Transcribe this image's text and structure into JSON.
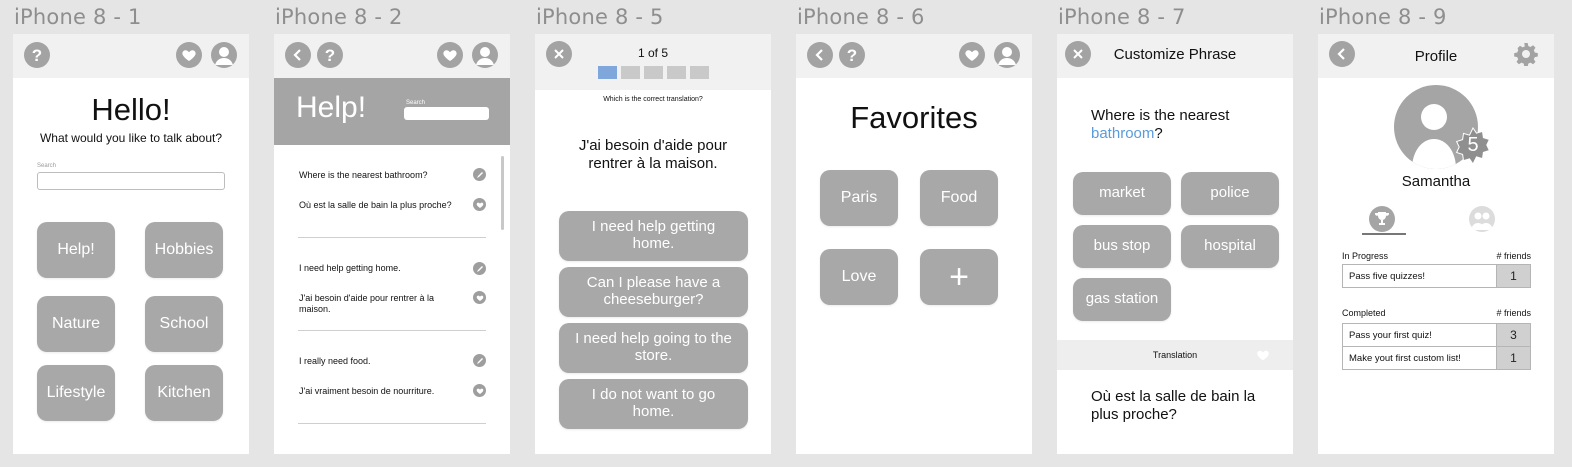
{
  "frames": {
    "f1": {
      "label": "iPhone 8 - 1",
      "title": "Hello!",
      "subtitle": "What would you like to talk about?",
      "search_label": "Search",
      "buttons": [
        "Help!",
        "Hobbies",
        "Nature",
        "School",
        "Lifestyle",
        "Kitchen"
      ]
    },
    "f2": {
      "label": "iPhone 8 - 2",
      "title": "Help!",
      "search_label": "Search",
      "phrases": [
        "Where is the nearest bathroom?",
        "Où est la salle de bain la plus proche?",
        "I need help getting home.",
        "J'ai besoin d'aide pour rentrer à la maison.",
        "I really need food.",
        "J'ai vraiment besoin de nourriture."
      ]
    },
    "f5": {
      "label": "iPhone 8 - 5",
      "progress": "1 of 5",
      "progress_value": 1,
      "progress_total": 5,
      "question": "Which is the correct translation?",
      "prompt": "J'ai besoin d'aide pour rentrer à la maison.",
      "answers": [
        "I need help getting home.",
        "Can I please have a cheeseburger?",
        "I need help going to the store.",
        "I do not want to go home."
      ]
    },
    "f6": {
      "label": "iPhone 8 - 6",
      "title": "Favorites",
      "tiles": [
        "Paris",
        "Food",
        "Love"
      ],
      "add_symbol": "+"
    },
    "f7": {
      "label": "iPhone 8 - 7",
      "title": "Customize Phrase",
      "phrase_start": "Where is the nearest ",
      "phrase_word": "bathroom",
      "phrase_end": "?",
      "options": [
        "market",
        "police",
        "bus stop",
        "hospital",
        "gas station"
      ],
      "translation_label": "Translation",
      "translation": "Où est la salle de bain la plus proche?"
    },
    "f9": {
      "label": "iPhone 8 - 9",
      "title": "Profile",
      "badge": "5",
      "name": "Samantha",
      "in_progress_label": "In Progress",
      "friends_label": "# friends",
      "in_progress": [
        {
          "name": "Pass five quizzes!",
          "friends": "1"
        }
      ],
      "completed_label": "Completed",
      "completed": [
        {
          "name": "Pass your first quiz!",
          "friends": "3"
        },
        {
          "name": "Make yout first custom list!",
          "friends": "1"
        }
      ]
    }
  },
  "colors": {
    "button_gray": "#a8a8a8",
    "accent_blue": "#5a9bdc",
    "progress_active": "#7fa7dc"
  }
}
